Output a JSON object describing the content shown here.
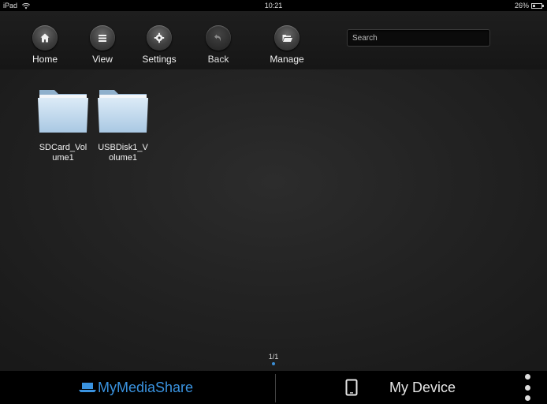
{
  "status": {
    "device": "iPad",
    "time": "10:21",
    "battery": "26%"
  },
  "toolbar": {
    "home": "Home",
    "view": "View",
    "settings": "Settings",
    "back": "Back",
    "manage": "Manage",
    "search_placeholder": "Search"
  },
  "folders": [
    {
      "line1": "SDCard_Vol",
      "line2": "ume1"
    },
    {
      "line1": "USBDisk1_V",
      "line2": "olume1"
    }
  ],
  "pager": {
    "label": "1/1"
  },
  "bottom": {
    "mymediashare": "MyMediaShare",
    "mydevice": "My Device"
  },
  "colors": {
    "accent": "#3a93e0",
    "folder": "#c4ddf0"
  },
  "icons": [
    "home-icon",
    "list-icon",
    "gear-icon",
    "back-arrow-icon",
    "folder-open-icon",
    "folder-icon",
    "tablet-icon",
    "more-vertical-icon",
    "wifi-icon",
    "battery-icon"
  ]
}
